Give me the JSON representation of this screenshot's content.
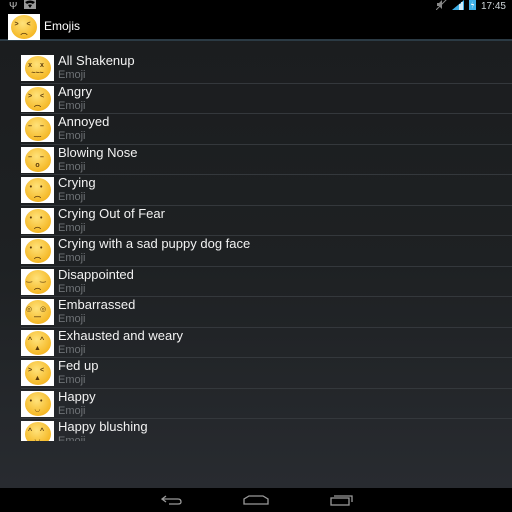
{
  "status_bar": {
    "left_icons": [
      "usb-icon",
      "wifi-icon"
    ],
    "right_icons": [
      "mute-icon",
      "signal-icon",
      "battery-icon"
    ],
    "time": "17:45"
  },
  "action_bar": {
    "app_icon": "angry-face-icon",
    "title": "Emojis"
  },
  "list": {
    "items": [
      {
        "title": "All Shakenup",
        "subtitle": "Emoji",
        "eyes": "x x",
        "mouth": "~~~",
        "icon": "confounded-face-icon"
      },
      {
        "title": "Angry",
        "subtitle": "Emoji",
        "eyes": "> <",
        "mouth": "︵",
        "icon": "angry-face-icon"
      },
      {
        "title": "Annoyed",
        "subtitle": "Emoji",
        "eyes": "– –",
        "mouth": "﹏",
        "icon": "unamused-face-icon"
      },
      {
        "title": "Blowing Nose",
        "subtitle": "Emoji",
        "eyes": "– –",
        "mouth": "o",
        "icon": "sleepy-face-icon"
      },
      {
        "title": "Crying",
        "subtitle": "Emoji",
        "eyes": "• •",
        "mouth": "︵",
        "icon": "crying-face-icon"
      },
      {
        "title": "Crying Out of Fear",
        "subtitle": "Emoji",
        "eyes": "• •",
        "mouth": "︵",
        "icon": "fearful-face-icon"
      },
      {
        "title": "Crying with a sad puppy dog face",
        "subtitle": "Emoji",
        "eyes": "• •",
        "mouth": "︵",
        "icon": "disappointed-relieved-face-icon"
      },
      {
        "title": "Disappointed",
        "subtitle": "Emoji",
        "eyes": "‿ ‿",
        "mouth": "︵",
        "icon": "disappointed-face-icon"
      },
      {
        "title": "Embarrassed",
        "subtitle": "Emoji",
        "eyes": "◎ ◎",
        "mouth": "—",
        "icon": "flushed-face-icon"
      },
      {
        "title": "Exhausted and weary",
        "subtitle": "Emoji",
        "eyes": "^ ^",
        "mouth": "▲",
        "icon": "weary-face-icon"
      },
      {
        "title": "Fed up",
        "subtitle": "Emoji",
        "eyes": "> <",
        "mouth": "▲",
        "icon": "tired-face-icon"
      },
      {
        "title": "Happy",
        "subtitle": "Emoji",
        "eyes": "• •",
        "mouth": "◡",
        "icon": "grinning-face-icon"
      },
      {
        "title": "Happy blushing",
        "subtitle": "Emoji",
        "eyes": "^ ^",
        "mouth": "◡",
        "icon": "blushing-face-icon"
      }
    ]
  },
  "nav_bar": {
    "buttons": [
      "back-icon",
      "home-icon",
      "recent-apps-icon"
    ]
  }
}
